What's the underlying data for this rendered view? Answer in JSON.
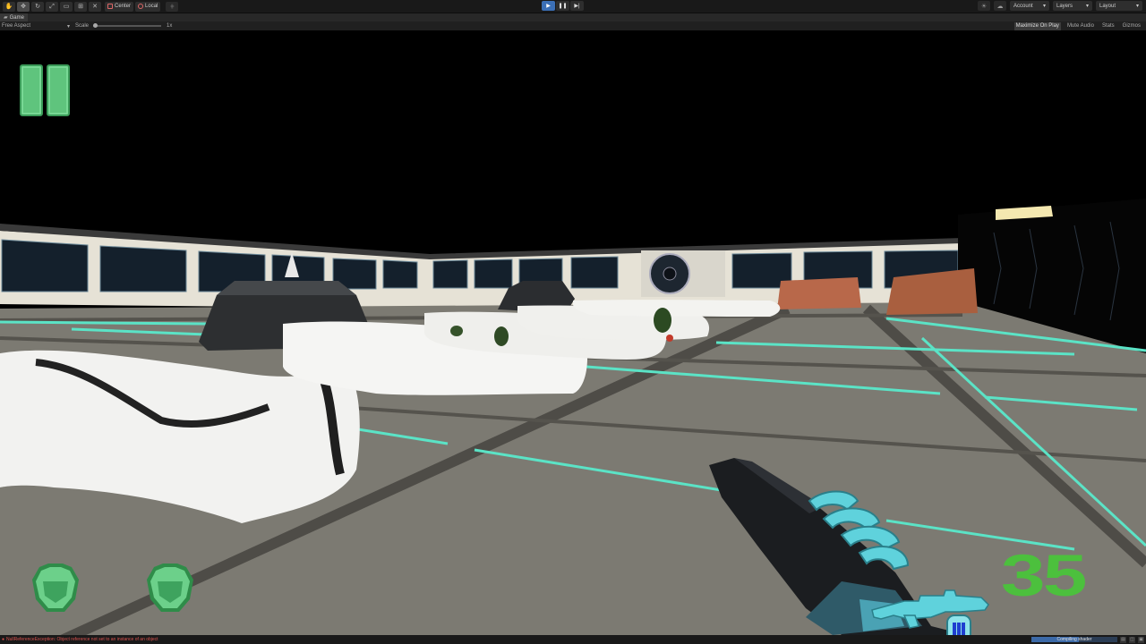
{
  "toolbar": {
    "tools": [
      "hand-tool",
      "move-tool",
      "rotate-tool",
      "scale-tool",
      "rect-tool",
      "transform-tool",
      "custom-tool"
    ],
    "pivot_label": "Center",
    "space_label": "Local",
    "account_label": "Account",
    "layers_label": "Layers",
    "layout_label": "Layout"
  },
  "tab": {
    "label": "Game"
  },
  "gamebar": {
    "aspect_label": "Free Aspect",
    "scale_label": "Scale",
    "scale_value": "1x",
    "maximize_label": "Maximize On Play",
    "mute_label": "Mute Audio",
    "stats_label": "Stats",
    "gizmos_label": "Gizmos"
  },
  "hud": {
    "ammo": "35",
    "lives": 2,
    "paused": true,
    "colors": {
      "hud_green": "#5fc47d",
      "ammo_green": "#4cc03d",
      "weapon_cyan": "#5fd2dc"
    }
  },
  "statusbar": {
    "error_text": "NullReferenceException: Object reference not set to an instance of an object",
    "progress_label": "Compiling shader",
    "progress_fraction": 0.55
  },
  "icons": {
    "toolbar": [
      "hand-icon",
      "move-icon",
      "rotate-icon",
      "scale-icon",
      "rect-icon",
      "transform-icon",
      "custom-icon"
    ],
    "right": [
      "light-icon",
      "cloud-icon"
    ]
  }
}
